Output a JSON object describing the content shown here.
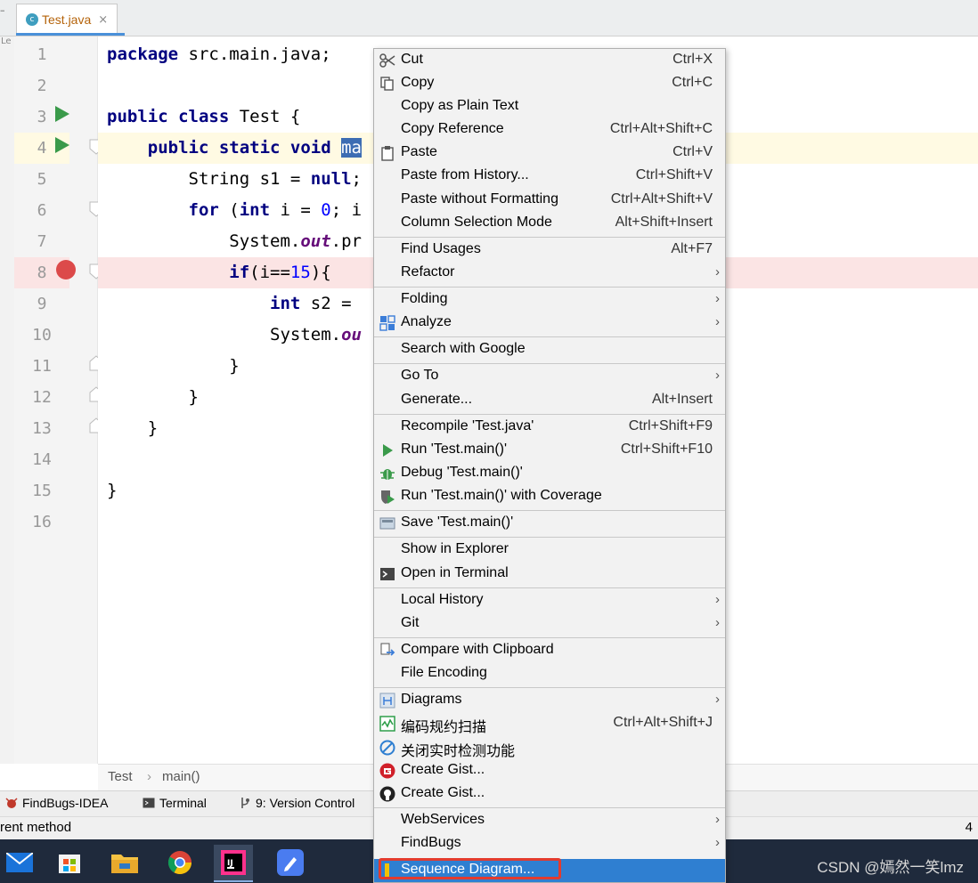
{
  "tab": {
    "label": "Test.java",
    "icon": "java-class-icon",
    "close": "×"
  },
  "left_strip": {
    "label": "Le"
  },
  "code": {
    "lines": [
      {
        "num": "1",
        "tokens": [
          {
            "t": "package ",
            "c": "kw"
          },
          {
            "t": "src.main.java;",
            "c": ""
          }
        ]
      },
      {
        "num": "2",
        "tokens": []
      },
      {
        "num": "3",
        "tokens": [
          {
            "t": "public class ",
            "c": "kw"
          },
          {
            "t": "Test {",
            "c": ""
          }
        ]
      },
      {
        "num": "4",
        "tokens": [
          {
            "t": "    public static void ",
            "c": "kw"
          },
          {
            "t": "ma",
            "c": "sel"
          }
        ]
      },
      {
        "num": "5",
        "tokens": [
          {
            "t": "        String s1 = ",
            "c": ""
          },
          {
            "t": "null",
            "c": "kw"
          },
          {
            "t": ";",
            "c": ""
          }
        ]
      },
      {
        "num": "6",
        "tokens": [
          {
            "t": "        for ",
            "c": "kw"
          },
          {
            "t": "(",
            "c": ""
          },
          {
            "t": "int ",
            "c": "kw"
          },
          {
            "t": "i = ",
            "c": ""
          },
          {
            "t": "0",
            "c": "num"
          },
          {
            "t": "; i",
            "c": ""
          }
        ]
      },
      {
        "num": "7",
        "tokens": [
          {
            "t": "            System.",
            "c": ""
          },
          {
            "t": "out",
            "c": "it"
          },
          {
            "t": ".pr",
            "c": ""
          }
        ]
      },
      {
        "num": "8",
        "tokens": [
          {
            "t": "            if",
            "c": "kw"
          },
          {
            "t": "(i==",
            "c": ""
          },
          {
            "t": "15",
            "c": "num"
          },
          {
            "t": "){",
            "c": ""
          }
        ]
      },
      {
        "num": "9",
        "tokens": [
          {
            "t": "                int ",
            "c": "kw"
          },
          {
            "t": "s2 =",
            "c": ""
          }
        ]
      },
      {
        "num": "10",
        "tokens": [
          {
            "t": "                System.",
            "c": ""
          },
          {
            "t": "ou",
            "c": "it"
          }
        ]
      },
      {
        "num": "11",
        "tokens": [
          {
            "t": "            }",
            "c": ""
          }
        ]
      },
      {
        "num": "12",
        "tokens": [
          {
            "t": "        }",
            "c": ""
          }
        ]
      },
      {
        "num": "13",
        "tokens": [
          {
            "t": "    }",
            "c": ""
          }
        ]
      },
      {
        "num": "14",
        "tokens": []
      },
      {
        "num": "15",
        "tokens": [
          {
            "t": "}",
            "c": ""
          }
        ]
      },
      {
        "num": "16",
        "tokens": []
      }
    ]
  },
  "breadcrumb": {
    "class": "Test",
    "separator": "›",
    "method": "main()"
  },
  "tool_windows": {
    "findbugs": "FindBugs-IDEA",
    "terminal": "Terminal",
    "vcs": "9: Version Control"
  },
  "status": {
    "text": "rent method",
    "right": "4"
  },
  "watermark": "CSDN @嫣然一笑lmz",
  "menu": {
    "items": [
      {
        "label": "Cut",
        "shortcut": "Ctrl+X",
        "icon": "scissors-icon"
      },
      {
        "label": "Copy",
        "shortcut": "Ctrl+C",
        "icon": "copy-icon"
      },
      {
        "label": "Copy as Plain Text",
        "shortcut": ""
      },
      {
        "label": "Copy Reference",
        "shortcut": "Ctrl+Alt+Shift+C"
      },
      {
        "label": "Paste",
        "shortcut": "Ctrl+V",
        "icon": "clipboard-icon"
      },
      {
        "label": "Paste from History...",
        "shortcut": "Ctrl+Shift+V"
      },
      {
        "label": "Paste without Formatting",
        "shortcut": "Ctrl+Alt+Shift+V"
      },
      {
        "label": "Column Selection Mode",
        "shortcut": "Alt+Shift+Insert"
      },
      {
        "label": "Find Usages",
        "shortcut": "Alt+F7"
      },
      {
        "label": "Refactor",
        "submenu": true
      },
      {
        "label": "Folding",
        "submenu": true
      },
      {
        "label": "Analyze",
        "submenu": true,
        "icon": "analyze-icon"
      },
      {
        "label": "Search with Google",
        "shortcut": ""
      },
      {
        "label": "Go To",
        "submenu": true
      },
      {
        "label": "Generate...",
        "shortcut": "Alt+Insert"
      },
      {
        "label": "Recompile 'Test.java'",
        "shortcut": "Ctrl+Shift+F9"
      },
      {
        "label": "Run 'Test.main()'",
        "shortcut": "Ctrl+Shift+F10",
        "icon": "run-icon"
      },
      {
        "label": "Debug 'Test.main()'",
        "shortcut": "",
        "icon": "debug-icon"
      },
      {
        "label": "Run 'Test.main()' with Coverage",
        "shortcut": "",
        "icon": "coverage-icon"
      },
      {
        "label": "Save 'Test.main()'",
        "shortcut": "",
        "icon": "save-config-icon"
      },
      {
        "label": "Show in Explorer",
        "shortcut": ""
      },
      {
        "label": "Open in Terminal",
        "shortcut": "",
        "icon": "terminal-icon"
      },
      {
        "label": "Local History",
        "submenu": true
      },
      {
        "label": "Git",
        "submenu": true
      },
      {
        "label": "Compare with Clipboard",
        "shortcut": "",
        "icon": "compare-icon"
      },
      {
        "label": "File Encoding",
        "shortcut": ""
      },
      {
        "label": "Diagrams",
        "submenu": true,
        "icon": "diagram-icon"
      },
      {
        "label": "编码规约扫描",
        "shortcut": "Ctrl+Alt+Shift+J",
        "icon": "scan-icon"
      },
      {
        "label": "关闭实时检测功能",
        "shortcut": "",
        "icon": "disable-icon"
      },
      {
        "label": "Create Gist...",
        "shortcut": "",
        "icon": "gitee-icon"
      },
      {
        "label": "Create Gist...",
        "shortcut": "",
        "icon": "github-icon"
      },
      {
        "label": "WebServices",
        "submenu": true
      },
      {
        "label": "FindBugs",
        "submenu": true
      },
      {
        "label": "Sequence Diagram...",
        "shortcut": "",
        "icon": "sequence-diagram-icon",
        "highlighted": true
      }
    ]
  },
  "colors": {
    "accent": "#2f7fd1",
    "highlight_box": "#e33b2e",
    "run": "#3a9a4a",
    "breakpoint": "#dc4a4a"
  }
}
